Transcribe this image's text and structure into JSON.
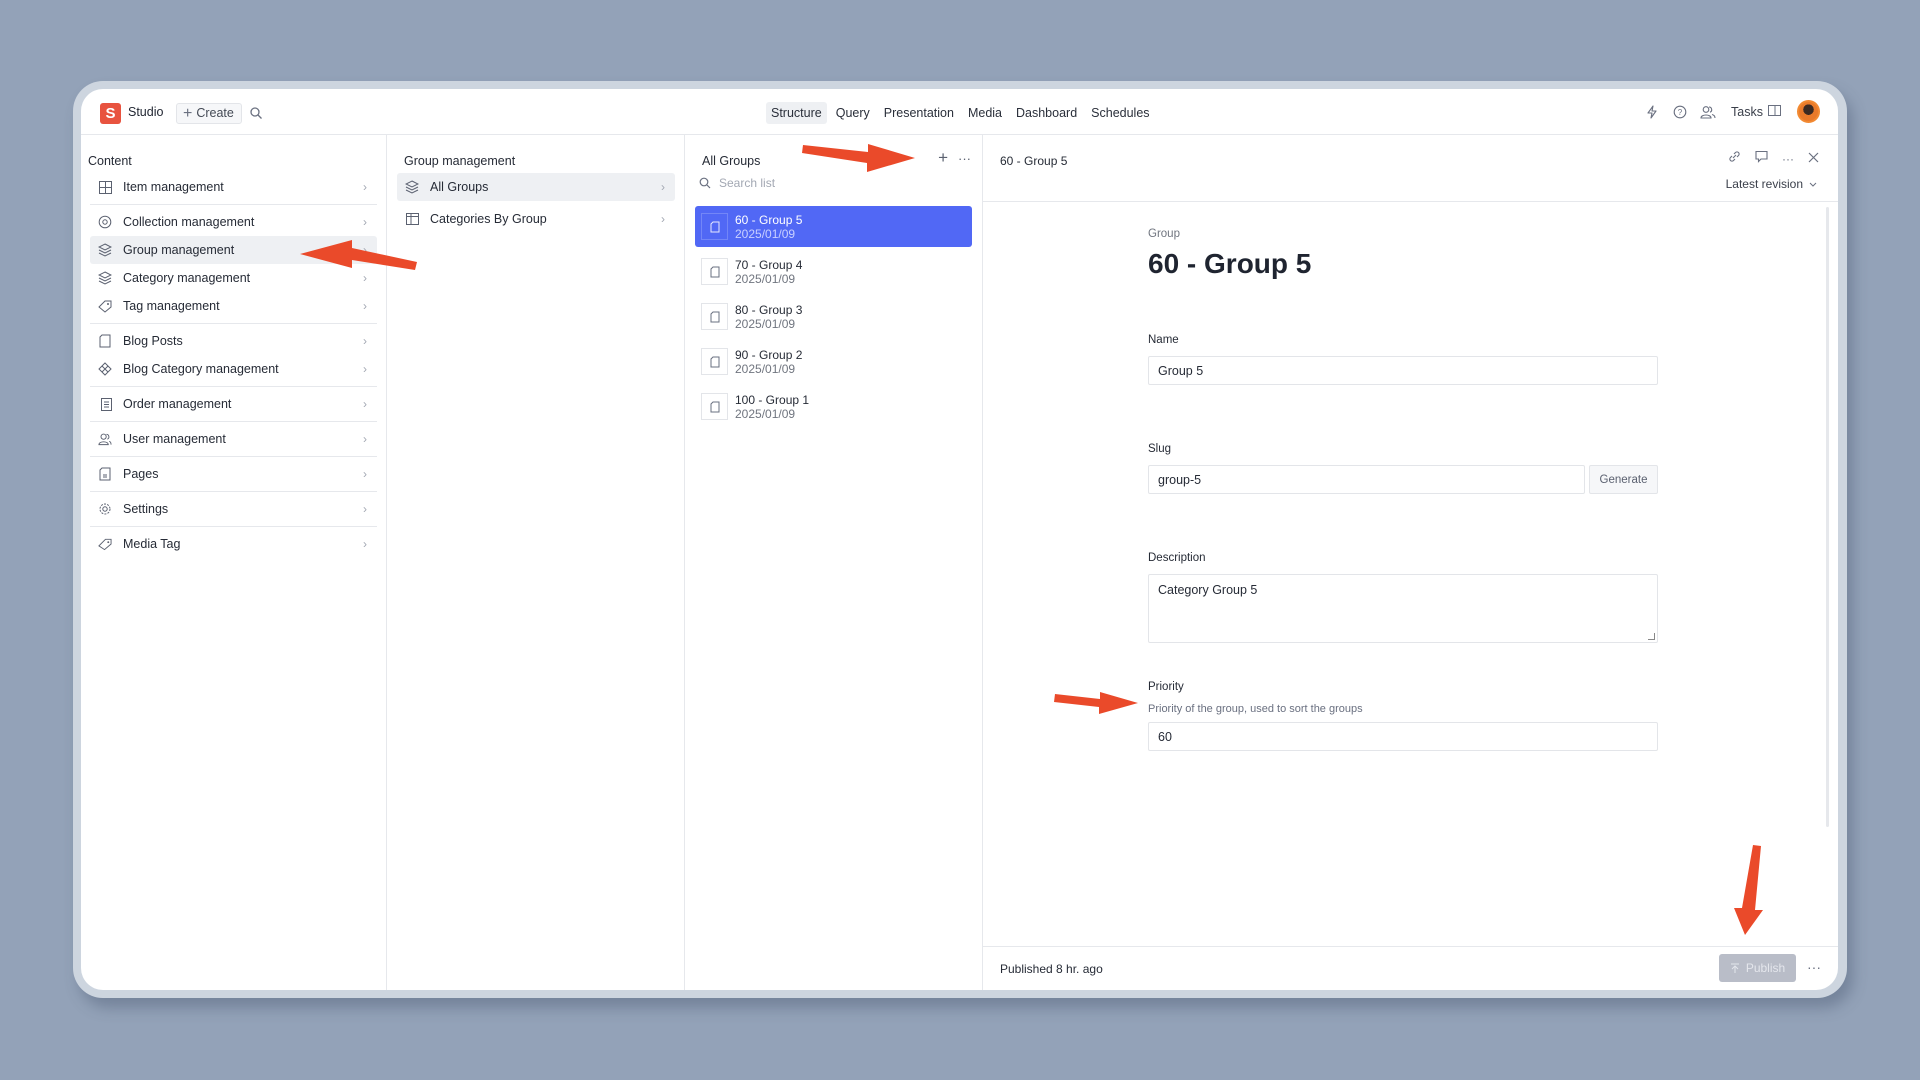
{
  "app": {
    "name": "Studio",
    "logo_letter": "S",
    "create_label": "Create"
  },
  "nav": {
    "tabs": [
      {
        "label": "Structure",
        "active": true
      },
      {
        "label": "Query",
        "active": false
      },
      {
        "label": "Presentation",
        "active": false
      },
      {
        "label": "Media",
        "active": false
      },
      {
        "label": "Dashboard",
        "active": false
      },
      {
        "label": "Schedules",
        "active": false
      }
    ]
  },
  "top_right": {
    "tasks_label": "Tasks",
    "icons": [
      "lightning-icon",
      "help-icon",
      "users-icon",
      "panel-icon",
      "avatar"
    ]
  },
  "content_pane": {
    "title": "Content",
    "items": [
      {
        "label": "Item management",
        "icon": "grid-icon"
      },
      {
        "label": "Collection management",
        "icon": "collection-icon"
      },
      {
        "label": "Group management",
        "icon": "layers-icon",
        "active": true
      },
      {
        "label": "Category management",
        "icon": "layers-icon"
      },
      {
        "label": "Tag management",
        "icon": "tag-icon"
      },
      {
        "label": "Blog Posts",
        "icon": "document-icon"
      },
      {
        "label": "Blog Category management",
        "icon": "diamond-icon"
      },
      {
        "label": "Order management",
        "icon": "list-icon"
      },
      {
        "label": "User management",
        "icon": "users-icon"
      },
      {
        "label": "Pages",
        "icon": "page-icon"
      },
      {
        "label": "Settings",
        "icon": "gear-icon"
      },
      {
        "label": "Media Tag",
        "icon": "tag-icon"
      }
    ]
  },
  "group_pane": {
    "title": "Group management",
    "items": [
      {
        "label": "All Groups",
        "icon": "layers-icon",
        "active": true
      },
      {
        "label": "Categories By Group",
        "icon": "table-icon"
      }
    ]
  },
  "list_pane": {
    "title": "All Groups",
    "search_placeholder": "Search list",
    "documents": [
      {
        "title": "60 - Group 5",
        "date": "2025/01/09",
        "active": true
      },
      {
        "title": "70 - Group 4",
        "date": "2025/01/09"
      },
      {
        "title": "80 - Group 3",
        "date": "2025/01/09"
      },
      {
        "title": "90 - Group 2",
        "date": "2025/01/09"
      },
      {
        "title": "100 - Group 1",
        "date": "2025/01/09"
      }
    ]
  },
  "editor": {
    "header_title": "60 - Group 5",
    "revision_label": "Latest revision",
    "type_label": "Group",
    "heading": "60 - Group 5",
    "fields": {
      "name": {
        "label": "Name",
        "value": "Group 5"
      },
      "slug": {
        "label": "Slug",
        "value": "group-5",
        "button": "Generate"
      },
      "description": {
        "label": "Description",
        "value": "Category Group 5"
      },
      "priority": {
        "label": "Priority",
        "description": "Priority of the group, used to sort the groups",
        "value": "60"
      }
    },
    "footer": {
      "status": "Published 8 hr. ago",
      "publish_label": "Publish"
    }
  },
  "colors": {
    "accent": "#5168f5",
    "brand": "#e8533f",
    "annotation": "#ea4a2a"
  }
}
